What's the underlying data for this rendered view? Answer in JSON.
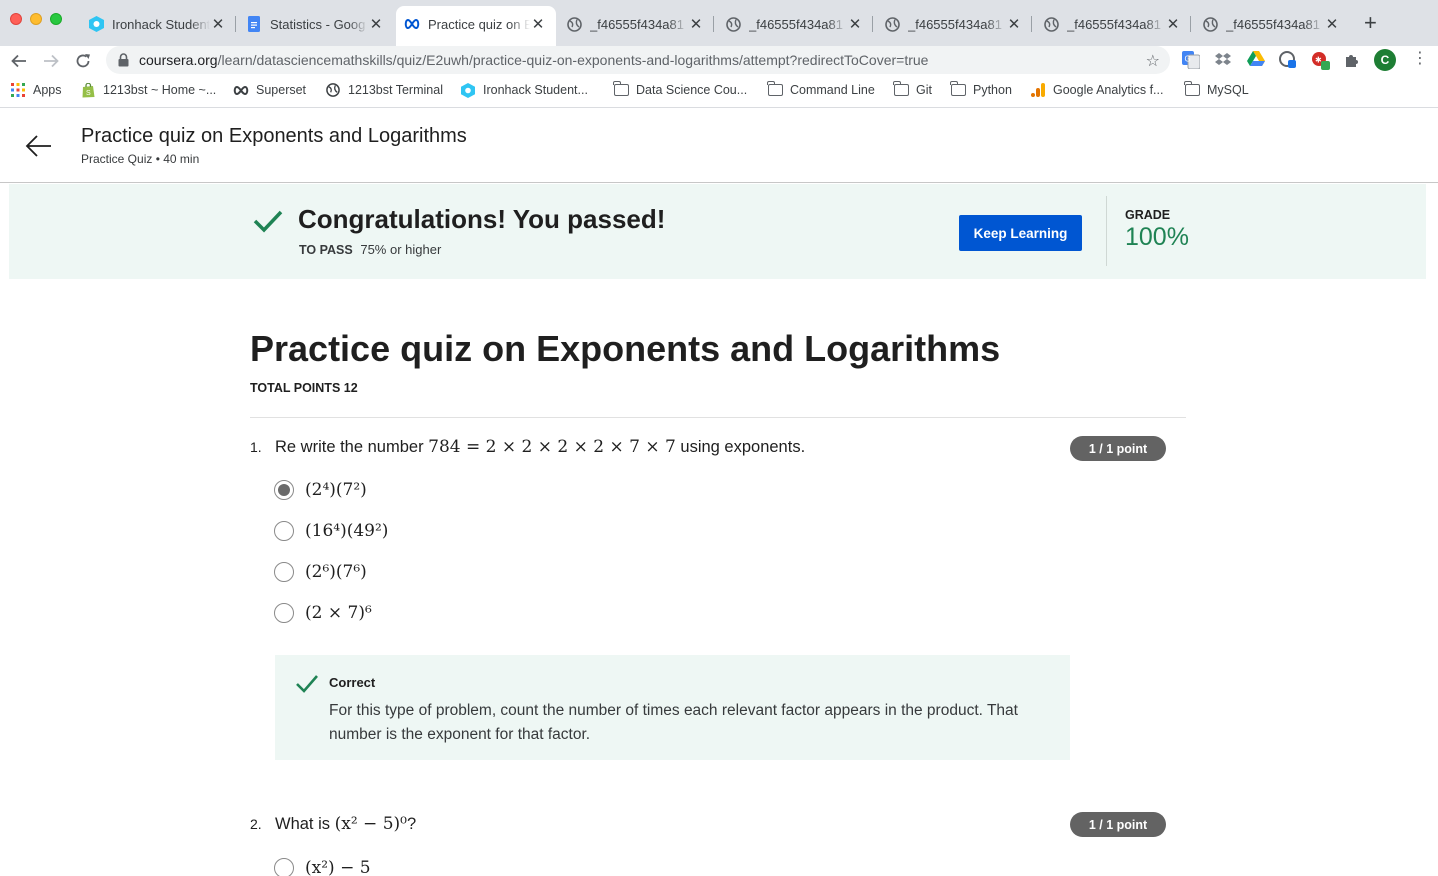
{
  "browser": {
    "tabs": [
      {
        "title": "Ironhack Student",
        "icon": "ironhack-hex-icon",
        "active": false
      },
      {
        "title": "Statistics - Goog",
        "icon": "google-docs-icon",
        "active": false
      },
      {
        "title": "Practice quiz on E",
        "icon": "coursera-infinity-icon",
        "active": true
      },
      {
        "title": "_f46555f434a81",
        "icon": "globe-icon",
        "active": false
      },
      {
        "title": "_f46555f434a81",
        "icon": "globe-icon",
        "active": false
      },
      {
        "title": "_f46555f434a81",
        "icon": "globe-icon",
        "active": false
      },
      {
        "title": "_f46555f434a81",
        "icon": "globe-icon",
        "active": false
      },
      {
        "title": "_f46555f434a81",
        "icon": "globe-icon",
        "active": false
      }
    ],
    "url_host": "coursera.org",
    "url_path": "/learn/datasciencemathskills/quiz/E2uwh/practice-quiz-on-exponents-and-logarithms/attempt?redirectToCover=true",
    "profile_initial": "C",
    "bookmarks": [
      {
        "label": "Apps",
        "icon": "apps-grid-icon"
      },
      {
        "label": "1213bst ~ Home ~...",
        "icon": "shopify-bag-icon"
      },
      {
        "label": "Superset",
        "icon": "superset-infinity-icon"
      },
      {
        "label": "1213bst Terminal",
        "icon": "globe-icon"
      },
      {
        "label": "Ironhack Student...",
        "icon": "ironhack-hex-icon"
      },
      {
        "label": "Data Science Cou...",
        "icon": "folder-icon"
      },
      {
        "label": "Command Line",
        "icon": "folder-icon"
      },
      {
        "label": "Git",
        "icon": "folder-icon"
      },
      {
        "label": "Python",
        "icon": "folder-icon"
      },
      {
        "label": "Google Analytics f...",
        "icon": "analytics-bars-icon"
      },
      {
        "label": "MySQL",
        "icon": "folder-icon"
      }
    ]
  },
  "header": {
    "title": "Practice quiz on Exponents and Logarithms",
    "subtitle": "Practice Quiz • 40 min"
  },
  "banner": {
    "message": "Congratulations! You passed!",
    "to_pass_label": "TO PASS",
    "to_pass_value": "75% or higher",
    "button_label": "Keep Learning",
    "grade_label": "GRADE",
    "grade_value": "100%",
    "accent_color": "#1f8354"
  },
  "quiz": {
    "title": "Practice quiz on Exponents and Logarithms",
    "total_points": "TOTAL POINTS 12",
    "questions": [
      {
        "number": "1.",
        "text_before": "Re write the number ",
        "math": "784 = 2 × 2 × 2 × 2 × 7 × 7",
        "text_after": " using exponents.",
        "points": "1 / 1 point",
        "options": [
          {
            "label": "(2⁴)(7²)",
            "selected": true
          },
          {
            "label": "(16⁴)(49²)",
            "selected": false
          },
          {
            "label": "(2⁶)(7⁶)",
            "selected": false
          },
          {
            "label": "(2 × 7)⁶",
            "selected": false
          }
        ],
        "feedback": {
          "status": "Correct",
          "text": "For this type of problem, count the number of times each relevant factor appears in the product. That number is the exponent for that factor."
        }
      },
      {
        "number": "2.",
        "text_before": "What is ",
        "math": "(x² − 5)⁰",
        "text_after": "?",
        "points": "1 / 1 point",
        "options": [
          {
            "label": "(x²) − 5",
            "selected": false
          }
        ]
      }
    ]
  }
}
